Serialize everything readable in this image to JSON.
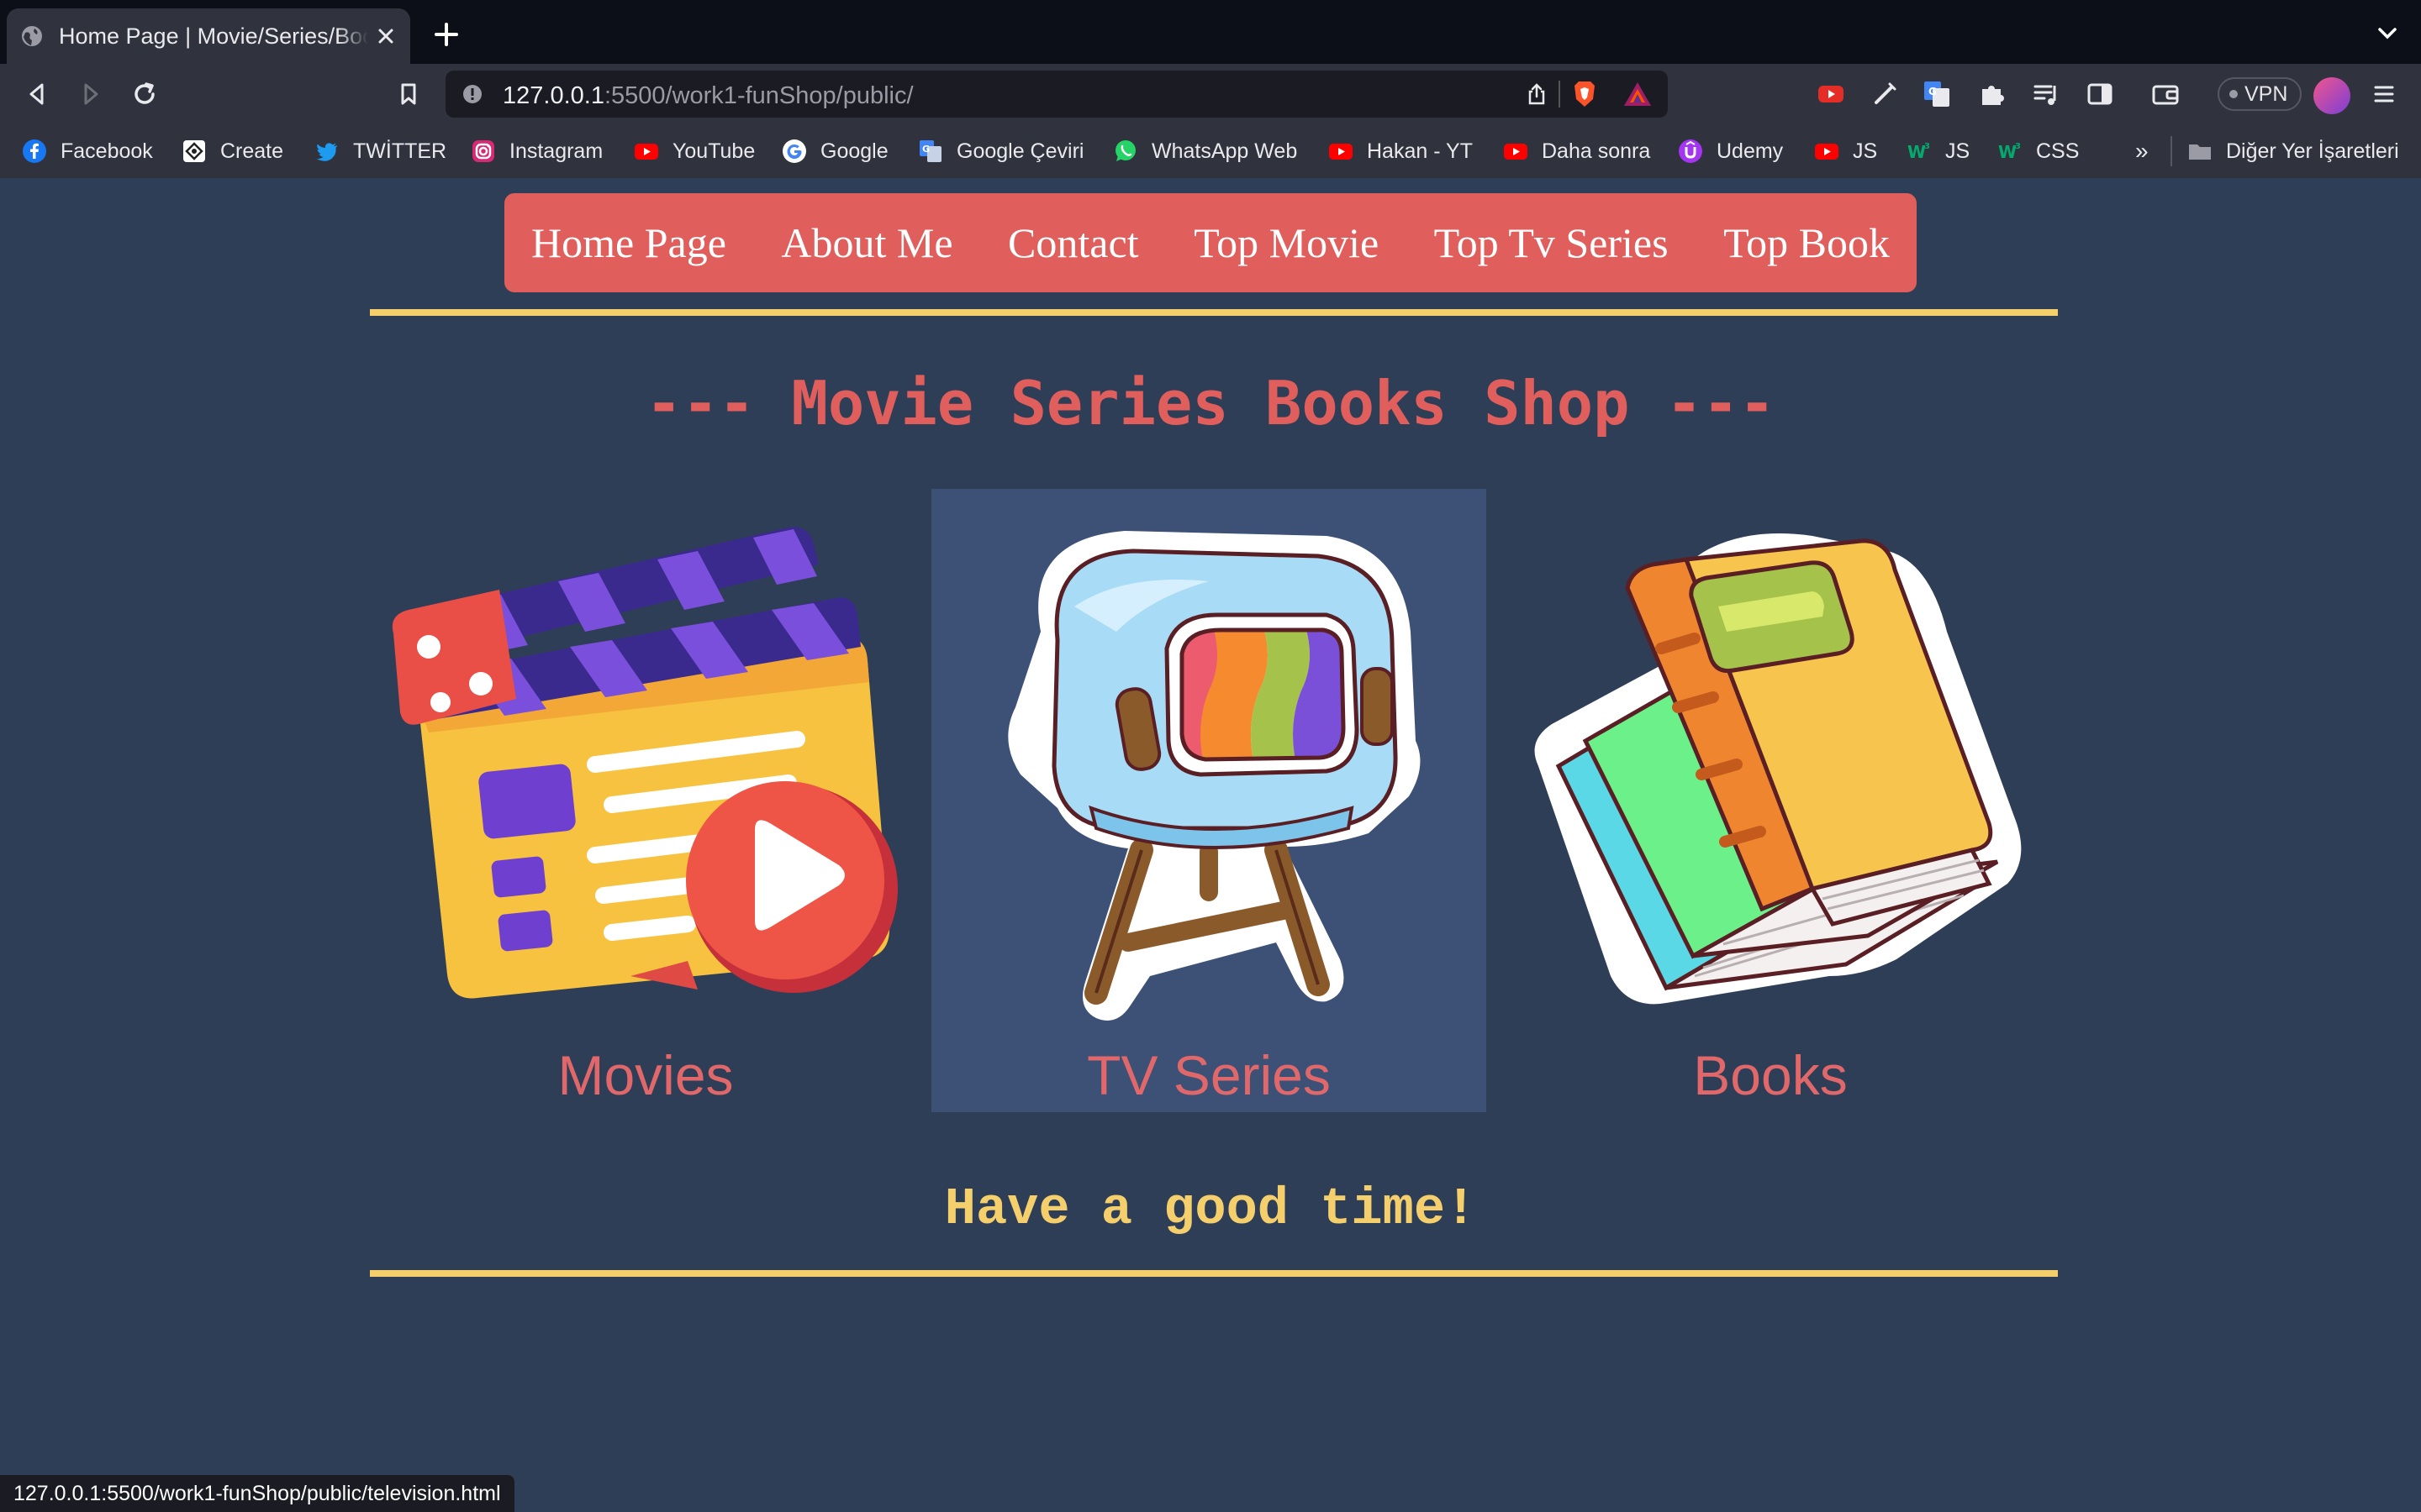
{
  "browser": {
    "tab": {
      "title": "Home Page | Movie/Series/Book"
    },
    "url": {
      "host": "127.0.0.1",
      "rest": ":5500/work1-funShop/public/"
    },
    "vpn_label": "VPN",
    "bookmarks": [
      {
        "label": "Facebook",
        "icon": "facebook-icon"
      },
      {
        "label": "Create",
        "icon": "create-icon"
      },
      {
        "label": "TWİTTER",
        "icon": "twitter-icon"
      },
      {
        "label": "Instagram",
        "icon": "instagram-icon"
      },
      {
        "label": "YouTube",
        "icon": "youtube-icon"
      },
      {
        "label": "Google",
        "icon": "google-icon"
      },
      {
        "label": "Google Çeviri",
        "icon": "google-translate-icon"
      },
      {
        "label": "WhatsApp Web",
        "icon": "whatsapp-icon"
      },
      {
        "label": "Hakan - YT",
        "icon": "youtube-icon"
      },
      {
        "label": "Daha sonra",
        "icon": "youtube-icon"
      },
      {
        "label": "Udemy",
        "icon": "udemy-icon"
      },
      {
        "label": "JS",
        "icon": "youtube-icon"
      },
      {
        "label": "JS",
        "icon": "w3schools-icon"
      },
      {
        "label": "CSS",
        "icon": "w3schools-icon"
      }
    ],
    "bookmarks_more": "»",
    "other_bookmarks": "Diğer Yer İşaretleri",
    "status_url": "127.0.0.1:5500/work1-funShop/public/television.html"
  },
  "nav": {
    "items": [
      "Home Page",
      "About Me",
      "Contact",
      "Top Movie",
      "Top Tv Series",
      "Top Book"
    ]
  },
  "headline": "--- Movie Series Books Shop ---",
  "cards": {
    "movies": "Movies",
    "tv": "TV Series",
    "books": "Books"
  },
  "tagline": "Have a good time!",
  "colors": {
    "page_bg": "#2f3e57",
    "nav_bg": "#e05f5c",
    "accent_yellow": "#f4cf6c",
    "headline": "#e05f5c",
    "card_hover": "#3c5175"
  }
}
